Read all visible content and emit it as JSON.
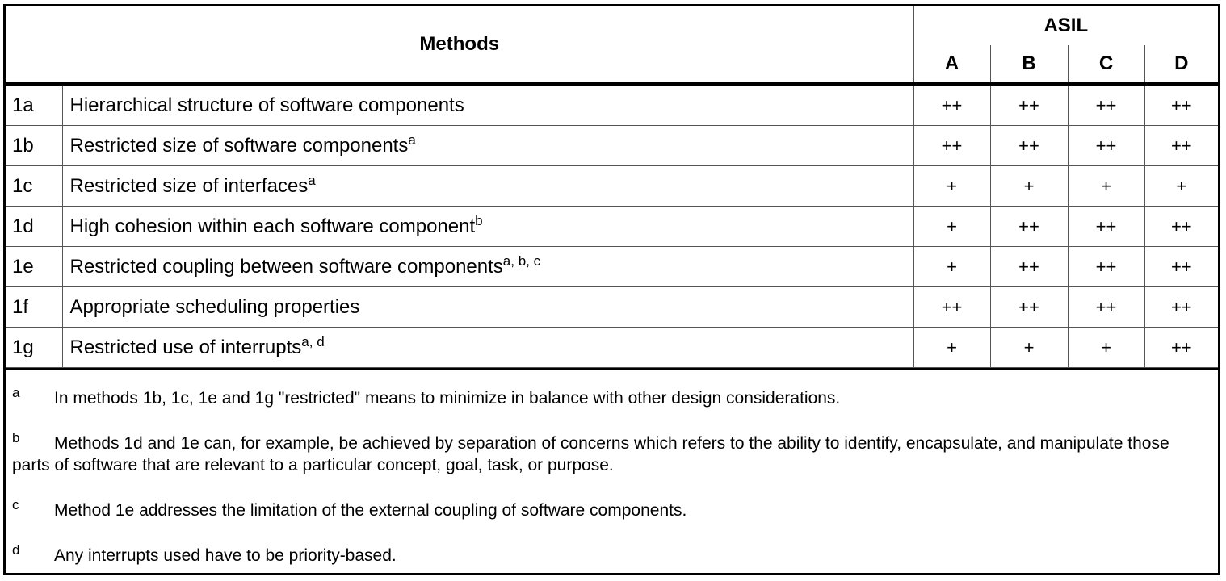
{
  "table": {
    "methods_header": "Methods",
    "asil_header": "ASIL",
    "levels": [
      "A",
      "B",
      "C",
      "D"
    ],
    "rows": [
      {
        "id": "1a",
        "name": "Hierarchical structure of software components",
        "sup": "",
        "values": [
          "++",
          "++",
          "++",
          "++"
        ]
      },
      {
        "id": "1b",
        "name": "Restricted size of software components",
        "sup": "a",
        "values": [
          "++",
          "++",
          "++",
          "++"
        ]
      },
      {
        "id": "1c",
        "name": "Restricted size of interfaces",
        "sup": "a",
        "values": [
          "+",
          "+",
          "+",
          "+"
        ]
      },
      {
        "id": "1d",
        "name": "High cohesion within each software component",
        "sup": "b",
        "values": [
          "+",
          "++",
          "++",
          "++"
        ]
      },
      {
        "id": "1e",
        "name": "Restricted coupling between software components",
        "sup": "a, b, c",
        "values": [
          "+",
          "++",
          "++",
          "++"
        ]
      },
      {
        "id": "1f",
        "name": "Appropriate scheduling properties",
        "sup": "",
        "values": [
          "++",
          "++",
          "++",
          "++"
        ]
      },
      {
        "id": "1g",
        "name": "Restricted use of interrupts",
        "sup": "a, d",
        "values": [
          "+",
          "+",
          "+",
          "++"
        ]
      }
    ]
  },
  "notes": [
    {
      "mark": "a",
      "text": "In methods 1b, 1c, 1e and 1g \"restricted\" means to minimize in balance with other design considerations."
    },
    {
      "mark": "b",
      "text": "Methods 1d and 1e can, for example, be achieved by separation of concerns which refers to the ability to identify, encapsulate, and manipulate those parts of software that are relevant to a particular concept, goal, task, or purpose."
    },
    {
      "mark": "c",
      "text": "Method 1e addresses the limitation of the external coupling of software components."
    },
    {
      "mark": "d",
      "text": "Any interrupts used have to be priority-based."
    }
  ]
}
